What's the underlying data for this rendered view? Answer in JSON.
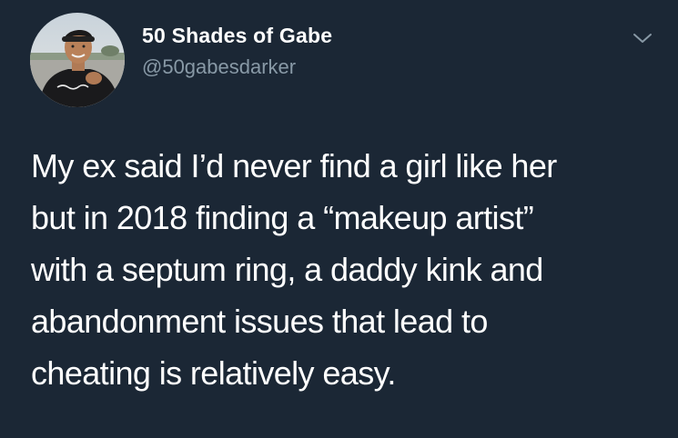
{
  "tweet": {
    "author": {
      "display_name": "50 Shades of Gabe",
      "handle": "@50gabesdarker",
      "avatar_icon": "profile-photo"
    },
    "menu_icon": "chevron-down-icon",
    "text_lines": [
      "My ex said I’d never find a girl like her",
      "but in 2018 finding a “makeup artist”",
      "with a septum ring, a daddy kink and",
      "abandonment issues that lead to",
      "cheating is relatively easy."
    ]
  },
  "colors": {
    "background": "#1b2735",
    "primary_text": "#ffffff",
    "secondary_text": "#8899a6"
  }
}
